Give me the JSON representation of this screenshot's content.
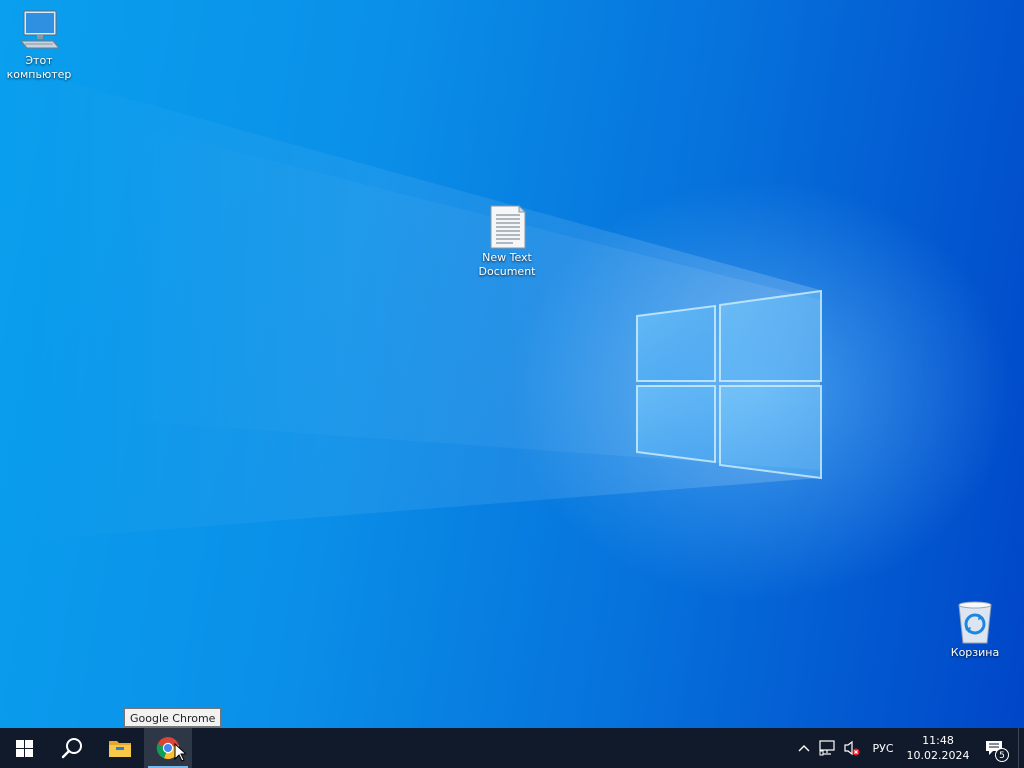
{
  "desktop": {
    "icons": [
      {
        "label": "Этот\nкомпьютер",
        "icon": "computer-icon"
      },
      {
        "label": "New Text\nDocument",
        "icon": "text-document-icon"
      },
      {
        "label": "Корзина",
        "icon": "recycle-bin-icon"
      }
    ]
  },
  "tooltip": {
    "text": "Google Chrome"
  },
  "taskbar": {
    "buttons": [
      {
        "name": "Start",
        "icon": "windows-start-icon"
      },
      {
        "name": "Search",
        "icon": "search-icon"
      },
      {
        "name": "File Explorer",
        "icon": "file-explorer-icon"
      },
      {
        "name": "Google Chrome",
        "icon": "chrome-icon",
        "state": "hovered"
      }
    ],
    "tray": {
      "chevron_icon": "chevron-up-icon",
      "network_icon": "network-icon",
      "volume_icon": "volume-muted-icon",
      "language": "РУС",
      "time": "11:48",
      "date": "10.02.2024",
      "notifications_icon": "notifications-icon",
      "notifications_count": "5"
    }
  },
  "colors": {
    "taskbar_bg": "#101a2a",
    "accent": "#76b9ed",
    "wallpaper_primary": "#0a8fe8"
  }
}
